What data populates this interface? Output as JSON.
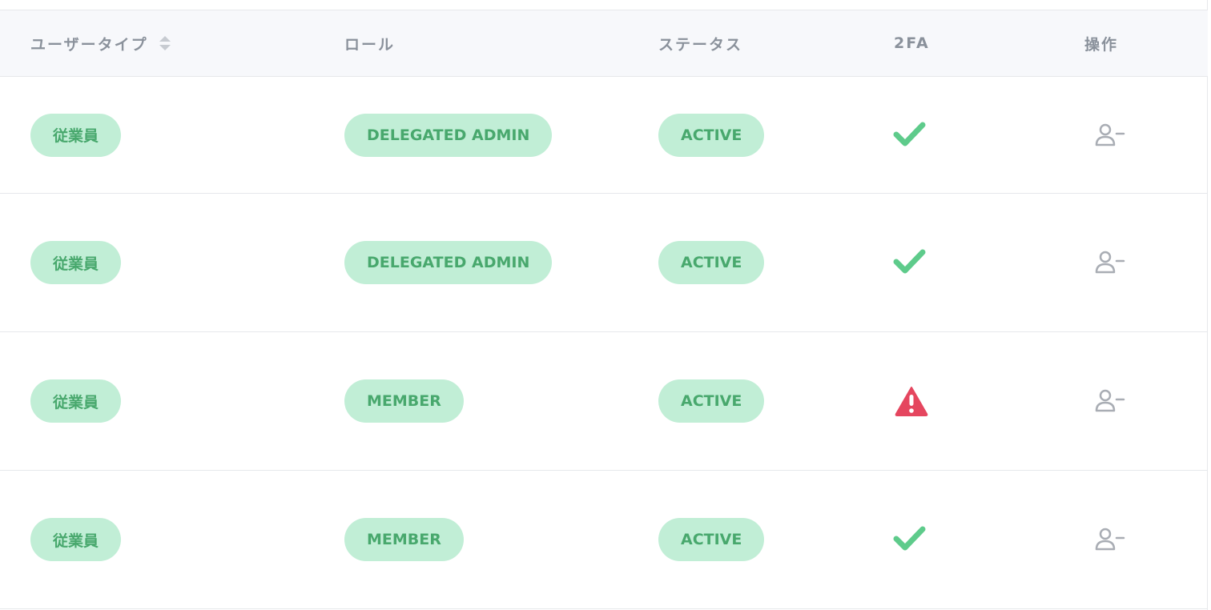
{
  "table": {
    "columns": [
      {
        "key": "user_type",
        "label": "ユーザータイプ",
        "sortable": true
      },
      {
        "key": "role",
        "label": "ロール"
      },
      {
        "key": "status",
        "label": "ステータス"
      },
      {
        "key": "twofa",
        "label": "2FA"
      },
      {
        "key": "actions",
        "label": "操作"
      }
    ],
    "rows": [
      {
        "user_type": "従業員",
        "role": "DELEGATED ADMIN",
        "status": "ACTIVE",
        "twofa": "check-icon",
        "action_icon": "remove-user-icon"
      },
      {
        "user_type": "従業員",
        "role": "DELEGATED ADMIN",
        "status": "ACTIVE",
        "twofa": "check-icon",
        "action_icon": "remove-user-icon"
      },
      {
        "user_type": "従業員",
        "role": "MEMBER",
        "status": "ACTIVE",
        "twofa": "warning-icon",
        "action_icon": "remove-user-icon"
      },
      {
        "user_type": "従業員",
        "role": "MEMBER",
        "status": "ACTIVE",
        "twofa": "check-icon",
        "action_icon": "remove-user-icon"
      }
    ]
  },
  "colors": {
    "pill_bg": "#c1eed6",
    "pill_text": "#48a86d",
    "check": "#5ecb8b",
    "warning": "#e5465f",
    "action_icon": "#a9adb4",
    "header_bg": "#f7f8fb",
    "header_text": "#8a919b"
  }
}
